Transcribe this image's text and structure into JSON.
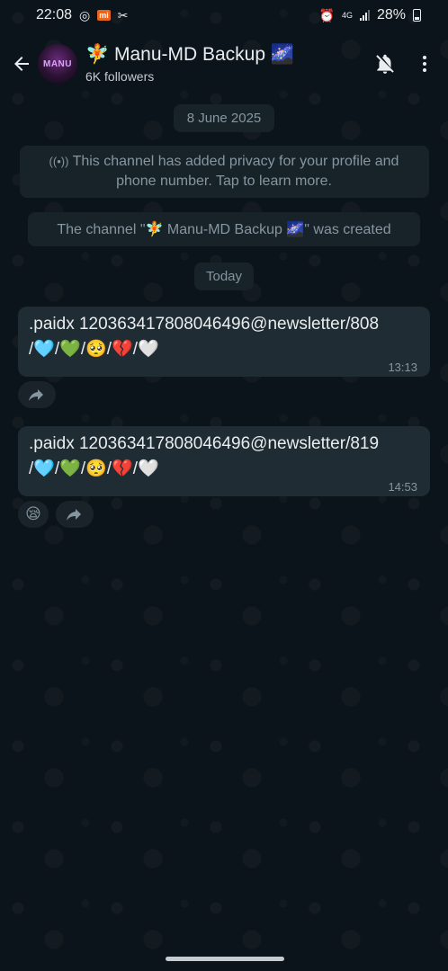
{
  "status_bar": {
    "time": "22:08",
    "network": "4G",
    "battery": "28%"
  },
  "header": {
    "back_icon": "arrow-left-icon",
    "avatar_text": "MANU",
    "title": "🧚 Manu-MD Backup 🌌",
    "followers": "6K followers",
    "mute_icon": "bell-off-icon",
    "more_icon": "more-vertical-icon"
  },
  "chat": {
    "date_chip": "8 June 2025",
    "privacy_notice": "This channel has added privacy for your profile and phone number. Tap to learn more.",
    "created_notice": "The channel \"🧚 Manu-MD Backup 🌌\" was created",
    "today_chip": "Today",
    "messages": [
      {
        "line1": ".paidx 120363417808046496@newsletter/808",
        "line2": "/🩵/💚/🥺/💔/🤍",
        "time": "13:13",
        "reaction": ""
      },
      {
        "line1": ".paidx 120363417808046496@newsletter/819",
        "line2": "/🩵/💚/🥺/💔/🤍",
        "time": "14:53",
        "reaction": "😪"
      }
    ]
  },
  "colors": {
    "background": "#0b141a",
    "bubble": "#1f2c33",
    "chip": "#182229",
    "secondary_text": "#8696a0"
  }
}
